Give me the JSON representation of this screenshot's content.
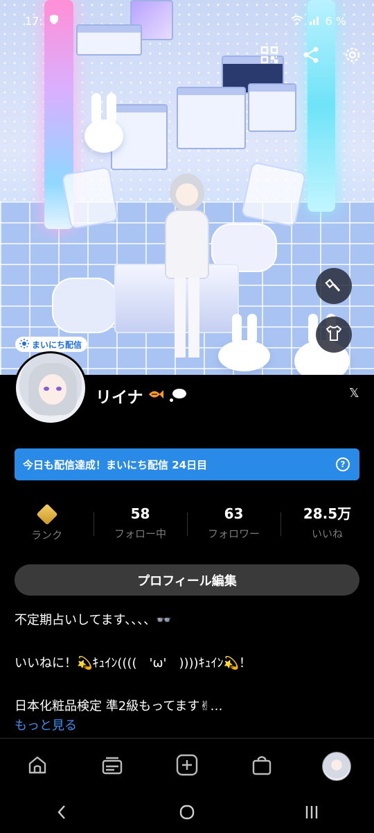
{
  "status_bar": {
    "time": "17:",
    "battery": "6 %"
  },
  "hero": {
    "daily_badge": "まいにち配信",
    "icons": [
      "qr-code-icon",
      "share-icon",
      "settings-icon"
    ],
    "side_buttons": [
      "brush-icon",
      "tshirt-icon"
    ]
  },
  "profile": {
    "name": "リイナ",
    "x_link": "𝕏",
    "banner_text": "今日も配信達成！まいにち配信 24日目",
    "banner_help": "?",
    "banner_color": "#2a8ae8"
  },
  "stats": [
    {
      "value": "",
      "label": "ランク"
    },
    {
      "value": "58",
      "label": "フォロー中"
    },
    {
      "value": "63",
      "label": "フォロワー"
    },
    {
      "value": "28.5万",
      "label": "いいね"
    }
  ],
  "edit_button": "プロフィール編集",
  "bio": {
    "line1": "不定期占いしてます、、、、👓",
    "line2": "いいねに！💫ｷｭｲﾝ((((　'ω'　))))ｷｭｲﾝ💫！",
    "line3": "日本化粧品検定 準2級もってます✌…",
    "more": "もっと見る"
  },
  "bottom_nav": [
    "home-icon",
    "feed-icon",
    "create-icon",
    "shop-icon",
    "profile-avatar"
  ],
  "system_nav": [
    "back-icon",
    "home-circle-icon",
    "recents-icon"
  ]
}
